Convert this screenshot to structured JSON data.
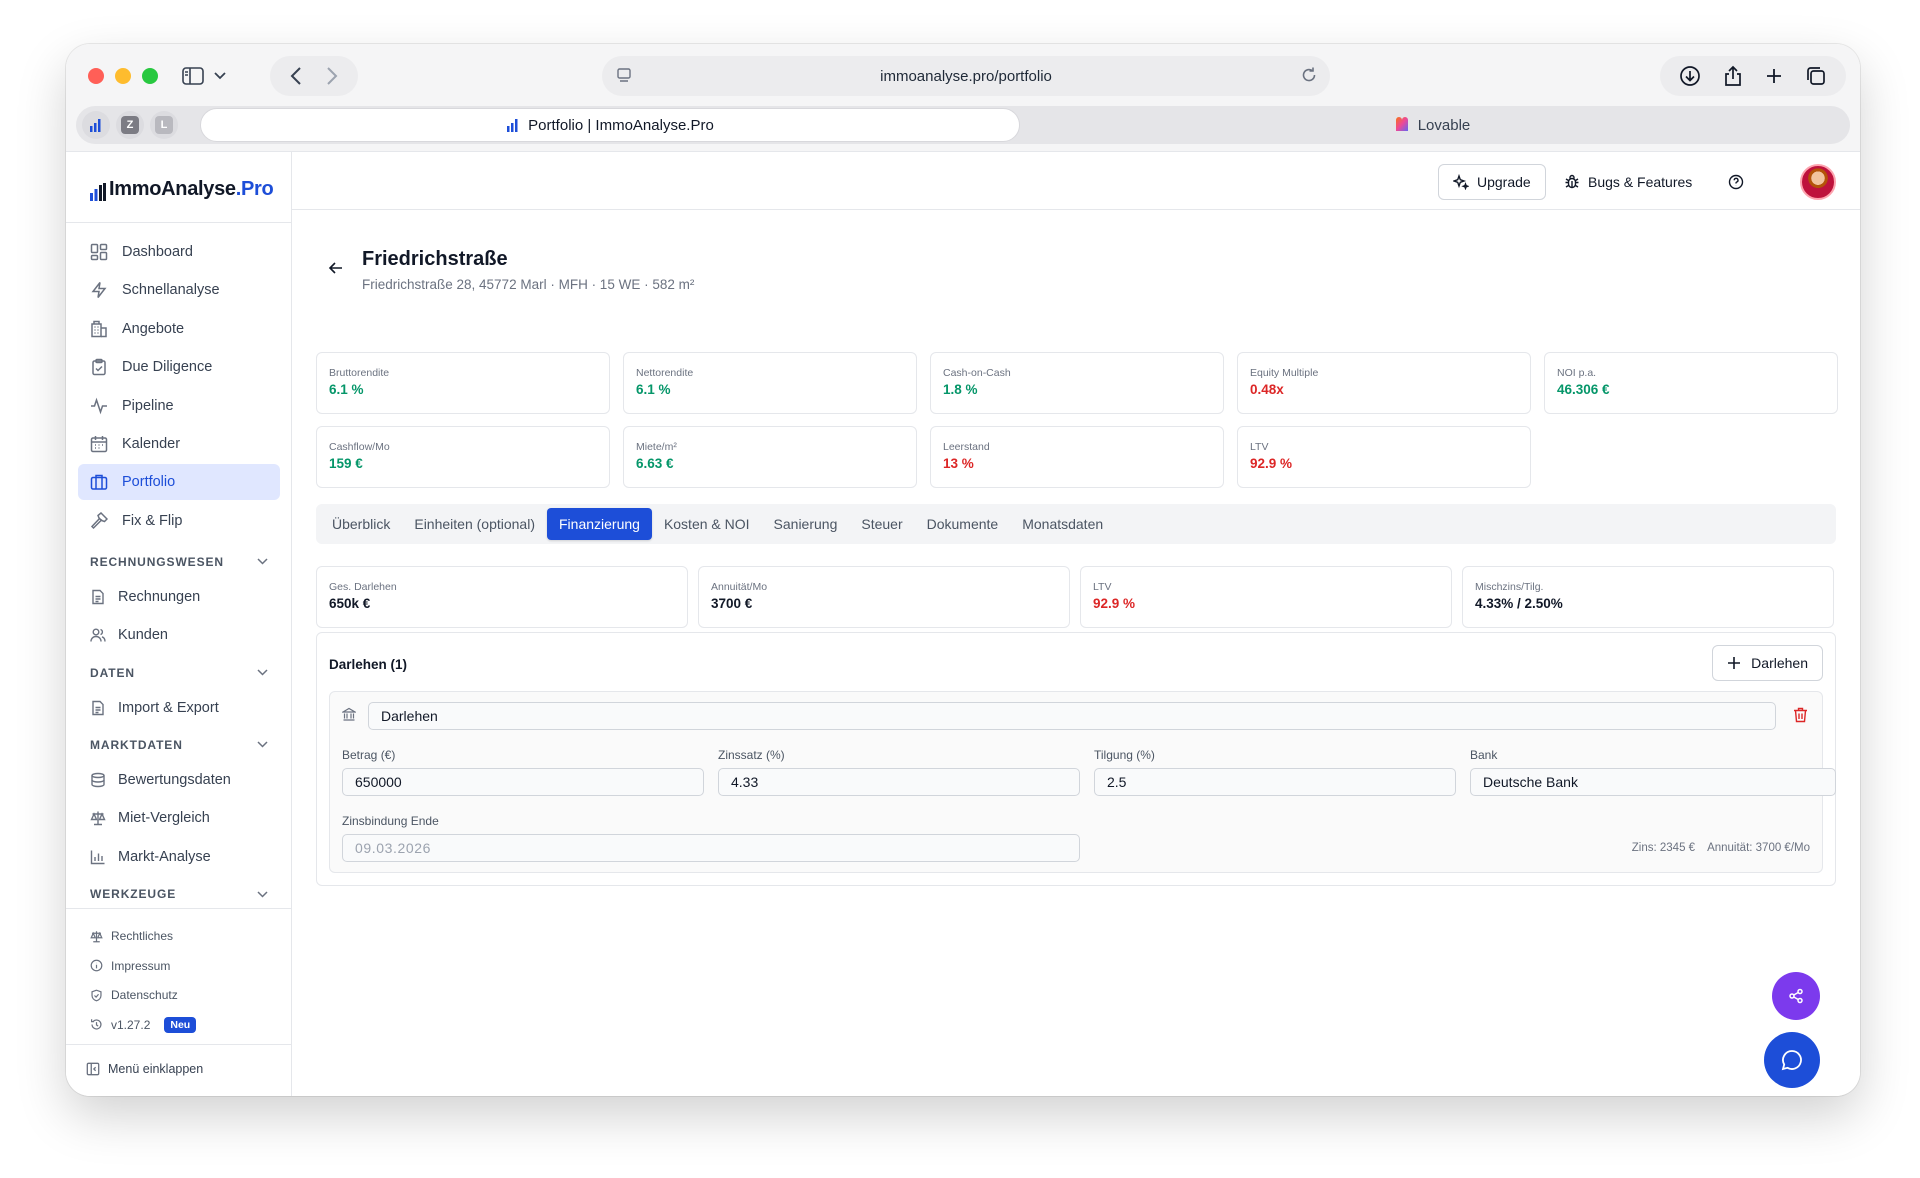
{
  "browser": {
    "url": "immoanalyse.pro/portfolio",
    "active_tab": "Portfolio | ImmoAnalyse.Pro",
    "inactive_tab": "Lovable",
    "favorites": [
      "Z",
      "L"
    ]
  },
  "app": {
    "logo_main": "ImmoAnalyse",
    "logo_suffix": ".Pro",
    "topbar": {
      "upgrade": "Upgrade",
      "bugs": "Bugs & Features"
    }
  },
  "sidebar": {
    "items": [
      {
        "label": "Dashboard",
        "icon": "dashboard-icon"
      },
      {
        "label": "Schnellanalyse",
        "icon": "bolt-icon"
      },
      {
        "label": "Angebote",
        "icon": "building-icon"
      },
      {
        "label": "Due Diligence",
        "icon": "clipboard-check-icon"
      },
      {
        "label": "Pipeline",
        "icon": "activity-icon"
      },
      {
        "label": "Kalender",
        "icon": "calendar-icon"
      },
      {
        "label": "Portfolio",
        "icon": "briefcase-icon"
      },
      {
        "label": "Fix & Flip",
        "icon": "hammer-icon"
      }
    ],
    "sections": [
      {
        "title": "RECHNUNGSWESEN",
        "items": [
          "Rechnungen",
          "Kunden"
        ]
      },
      {
        "title": "DATEN",
        "items": [
          "Import & Export"
        ]
      },
      {
        "title": "MARKTDATEN",
        "items": [
          "Bewertungsdaten",
          "Miet-Vergleich",
          "Markt-Analyse"
        ]
      },
      {
        "title": "WERKZEUGE",
        "items": []
      }
    ],
    "footer": {
      "legal": "Rechtliches",
      "imprint": "Impressum",
      "privacy": "Datenschutz",
      "version": "v1.27.2",
      "new_badge": "Neu",
      "collapse": "Menü einklappen"
    }
  },
  "property": {
    "title": "Friedrichstraße",
    "subtitle": "Friedrichstraße 28, 45772 Marl · MFH · 15 WE · 582 m²"
  },
  "kpis": [
    {
      "label": "Bruttorendite",
      "value": "6.1 %",
      "status_color": "#059669"
    },
    {
      "label": "Nettorendite",
      "value": "6.1 %",
      "status_color": "#059669"
    },
    {
      "label": "Cash-on-Cash",
      "value": "1.8 %",
      "status_color": "#059669"
    },
    {
      "label": "Equity Multiple",
      "value": "0.48x",
      "status_color": "#dc2626"
    },
    {
      "label": "NOI p.a.",
      "value": "46.306 €",
      "status_color": "#059669"
    },
    {
      "label": "Cashflow/Mo",
      "value": "159 €",
      "status_color": "#059669"
    },
    {
      "label": "Miete/m²",
      "value": "6.63 €",
      "status_color": "#059669"
    },
    {
      "label": "Leerstand",
      "value": "13 %",
      "status_color": "#dc2626"
    },
    {
      "label": "LTV",
      "value": "92.9 %",
      "status_color": "#dc2626"
    }
  ],
  "tabs": [
    "Überblick",
    "Einheiten (optional)",
    "Finanzierung",
    "Kosten & NOI",
    "Sanierung",
    "Steuer",
    "Dokumente",
    "Monatsdaten"
  ],
  "active_tab_index": 2,
  "summary": [
    {
      "label": "Ges. Darlehen",
      "value": "650k €",
      "status_color": "#111827"
    },
    {
      "label": "Annuität/Mo",
      "value": "3700 €",
      "status_color": "#111827"
    },
    {
      "label": "LTV",
      "value": "92.9 %",
      "status_color": "#dc2626"
    },
    {
      "label": "Mischzins/Tilg.",
      "value": "4.33% / 2.50%",
      "status_color": "#111827"
    }
  ],
  "loans": {
    "title": "Darlehen (1)",
    "add_button": "Darlehen",
    "loan": {
      "name": "Darlehen",
      "betrag_label": "Betrag (€)",
      "betrag": "650000",
      "zinssatz_label": "Zinssatz (%)",
      "zinssatz": "4.33",
      "tilgung_label": "Tilgung (%)",
      "tilgung": "2.5",
      "bank_label": "Bank",
      "bank": "Deutsche Bank",
      "zinsbindung_label": "Zinsbindung Ende",
      "zinsbindung": "09.03.2026",
      "zins_hint": "Zins: 2345 €",
      "annuitaet_hint": "Annuität: 3700 €/Mo"
    }
  },
  "colors": {
    "accent": "#1d4ed8",
    "positive": "#059669",
    "negative": "#dc2626"
  }
}
